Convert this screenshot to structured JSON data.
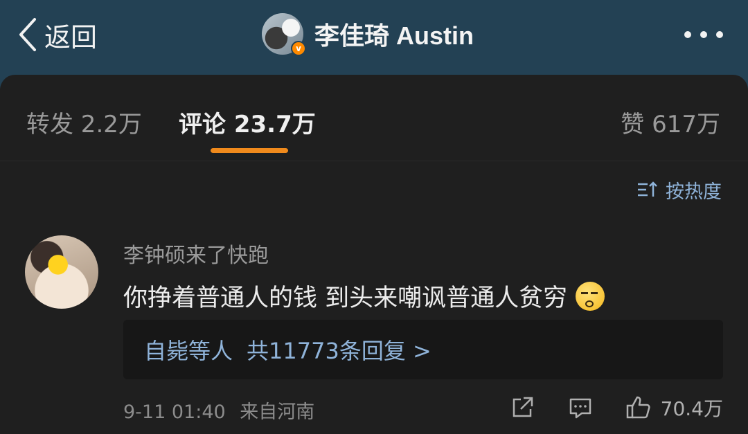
{
  "header": {
    "back_label": "返回",
    "account_name": "李佳琦 Austin",
    "verified_badge": "v",
    "more_icon": "more-dots-icon"
  },
  "tabs": [
    {
      "label": "转发 2.2万",
      "active": false
    },
    {
      "label": "评论 23.7万",
      "active": true
    },
    {
      "label": "赞 617万",
      "active": false
    }
  ],
  "sort": {
    "label": "按热度",
    "icon": "sort-icon"
  },
  "comment": {
    "username": "李钟硕来了快跑",
    "text": "你挣着普通人的钱 到头来嘲讽普通人贫穷",
    "emoji": "smirk-emoji",
    "reply": {
      "user": "自毙等人",
      "count_text": "共11773条回复 >"
    },
    "time": "9-11 01:40",
    "location": "来自河南",
    "likes": "70.4万"
  },
  "colors": {
    "header_bg": "#234154",
    "card_bg": "#1f1f1f",
    "accent_orange": "#f08a1c",
    "link_blue": "#8fb3d9"
  }
}
